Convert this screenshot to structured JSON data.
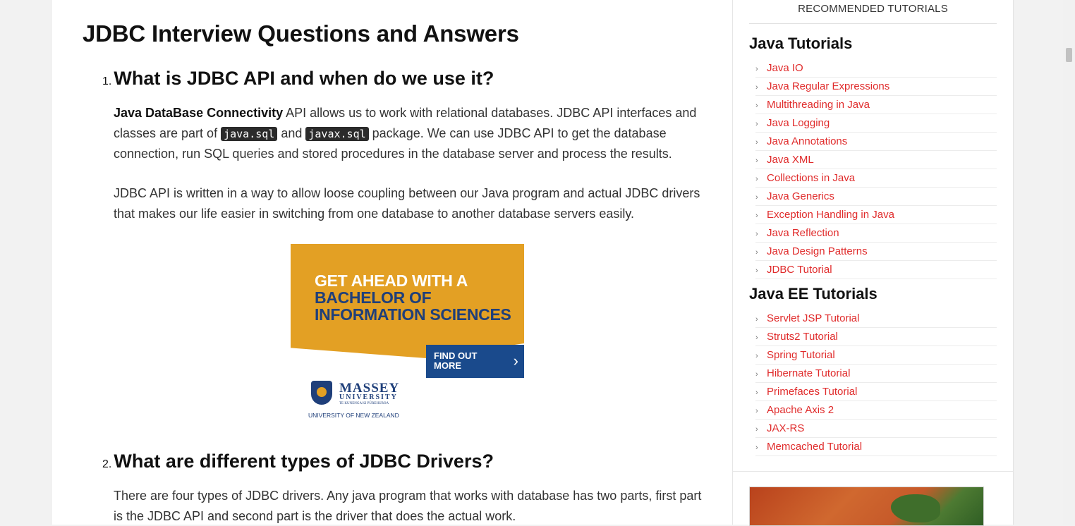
{
  "article": {
    "title": "JDBC Interview Questions and Answers",
    "questions": [
      {
        "number": "1.",
        "heading": "What is JDBC API and when do we use it?",
        "p1": {
          "bold": "Java DataBase Connectivity",
          "t1": " API allows us to work with relational databases. JDBC API interfaces and classes are part of ",
          "code1": "java.sql",
          "t2": " and ",
          "code2": "javax.sql",
          "t3": " package. We can use JDBC API to get the database connection, run SQL queries and stored procedures in the database server and process the results."
        },
        "p2": "JDBC API is written in a way to allow loose coupling between our Java program and actual JDBC drivers that makes our life easier in switching from one database to another database servers easily."
      },
      {
        "number": "2.",
        "heading": "What are different types of JDBC Drivers?",
        "p1": "There are four types of JDBC drivers. Any java program that works with database has two parts, first part is the JDBC API and second part is the driver that does the actual work."
      }
    ]
  },
  "ad": {
    "line1": "GET AHEAD WITH A",
    "line2": "BACHELOR OF",
    "line3": "INFORMATION SCIENCES",
    "cta": "FIND OUT MORE",
    "cta_arrow": "›",
    "logo_name": "MASSEY",
    "logo_sub": "UNIVERSITY",
    "logo_maori": "TE KUNENGA KI PŪREHUROA",
    "logo_nz": "UNIVERSITY OF NEW ZEALAND",
    "colors": {
      "gold": "#e3a024",
      "navy": "#1a4a8c"
    }
  },
  "sidebar": {
    "recommended": "RECOMMENDED TUTORIALS",
    "sections": [
      {
        "title": "Java Tutorials",
        "links": [
          "Java IO",
          "Java Regular Expressions",
          "Multithreading in Java",
          "Java Logging",
          "Java Annotations",
          "Java XML",
          "Collections in Java",
          "Java Generics",
          "Exception Handling in Java",
          "Java Reflection",
          "Java Design Patterns",
          "JDBC Tutorial"
        ]
      },
      {
        "title": "Java EE Tutorials",
        "links": [
          "Servlet JSP Tutorial",
          "Struts2 Tutorial",
          "Spring Tutorial",
          "Hibernate Tutorial",
          "Primefaces Tutorial",
          "Apache Axis 2",
          "JAX-RS",
          "Memcached Tutorial"
        ]
      }
    ],
    "link_color": "#e02b2b",
    "bullet": "›"
  }
}
